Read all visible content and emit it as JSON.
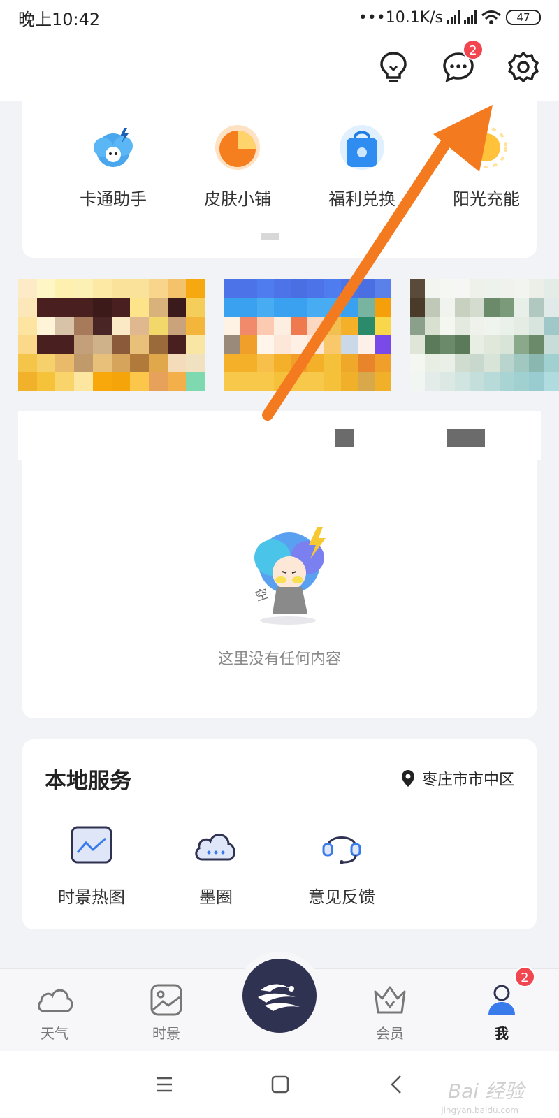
{
  "status_bar": {
    "time": "晚上10:42",
    "network_speed": "•••10.1K/s",
    "battery": "47"
  },
  "top_bar": {
    "icons": [
      "lightbulb-icon",
      "chat-icon",
      "settings-icon"
    ],
    "message_badge": "2"
  },
  "tools": [
    {
      "label": "卡通助手",
      "icon": "cartoon-assistant-icon"
    },
    {
      "label": "皮肤小铺",
      "icon": "skin-shop-icon"
    },
    {
      "label": "福利兑换",
      "icon": "welfare-exchange-icon"
    },
    {
      "label": "阳光充能",
      "icon": "sunshine-charge-icon"
    }
  ],
  "empty_state": {
    "text": "这里没有任何内容"
  },
  "local_services": {
    "title": "本地服务",
    "location": "枣庄市市中区",
    "items": [
      {
        "label": "时景热图",
        "icon": "heatmap-icon"
      },
      {
        "label": "墨圈",
        "icon": "cloud-circle-icon"
      },
      {
        "label": "意见反馈",
        "icon": "headset-icon"
      }
    ]
  },
  "tab_bar": {
    "tabs": [
      {
        "label": "天气",
        "icon": "cloud-icon"
      },
      {
        "label": "时景",
        "icon": "image-icon"
      },
      {
        "label": "会员",
        "icon": "crown-icon"
      },
      {
        "label": "我",
        "icon": "person-icon"
      }
    ],
    "profile_badge": "2",
    "active": "我"
  },
  "watermark": {
    "text": "Bai 经验",
    "sub": "jingyan.baidu.com"
  },
  "colors": {
    "accent_orange": "#f47a20",
    "badge_red": "#f1454f",
    "center_button": "#2f3250",
    "active_tab": "#3a7bec"
  }
}
